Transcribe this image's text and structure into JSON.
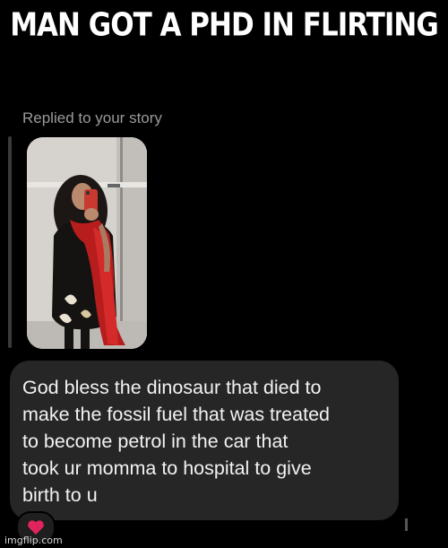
{
  "meme": {
    "caption": "MAN GOT A PHD IN FLIRTING"
  },
  "message": {
    "replied_label": "Replied to your story",
    "text": "God bless the dinosaur that died to\nmake the fossil fuel that was treated\nto become petrol in the car that\ntook ur momma to hospital to give\nbirth to u",
    "reaction_icon": "heart-icon",
    "reaction_color": "#e0245e"
  },
  "watermark": "imgflip.com",
  "colors": {
    "background": "#000000",
    "bubble": "#262626",
    "muted_text": "#9a9a9a"
  }
}
